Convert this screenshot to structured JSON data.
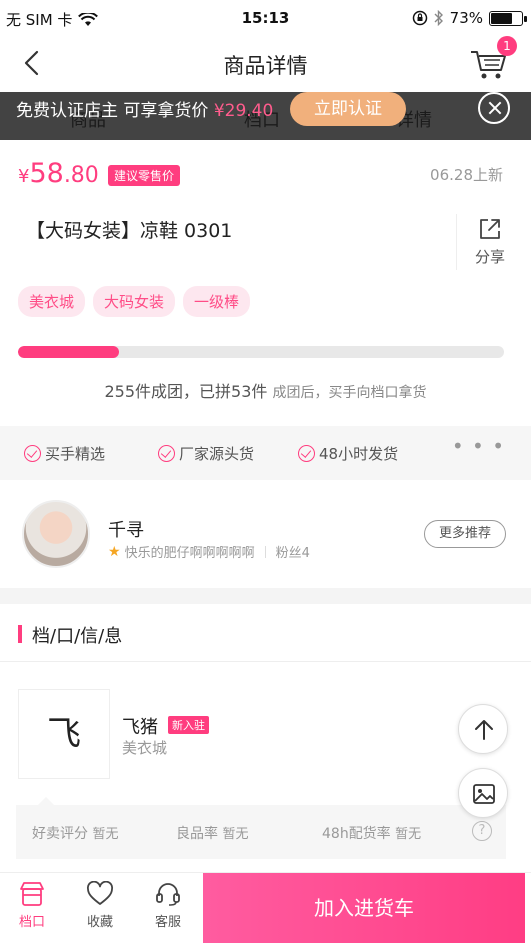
{
  "status_bar": {
    "carrier": "无 SIM 卡",
    "time": "15:13",
    "battery": "73%",
    "battery_level": 0.73
  },
  "nav": {
    "title": "商品详情",
    "cart_count": "1"
  },
  "ghost_tabs": [
    "商品",
    "档口",
    "详情"
  ],
  "promo": {
    "text": "免费认证店主 可享拿货价",
    "price": "¥29.40",
    "button": "立即认证"
  },
  "product": {
    "currency": "¥",
    "price_int": "58",
    "price_dec": ".80",
    "suggest_tag": "建议零售价",
    "date": "06.28上新",
    "title": "【大码女装】凉鞋 0301",
    "share_label": "分享",
    "tags": [
      "美衣城",
      "大码女装",
      "一级棒"
    ]
  },
  "group": {
    "progress": 0.208,
    "text_main": "255件成团，已拼53件",
    "text_sub": "成团后，买手向档口拿货"
  },
  "features": [
    "买手精选",
    "厂家源头货",
    "48小时发货"
  ],
  "more_dots": "• • •",
  "author": {
    "name": "千寻",
    "motto": "快乐的肥仔啊啊啊啊啊",
    "fans": "粉丝4",
    "more_button": "更多推荐"
  },
  "stall": {
    "section_title": "档/口/信/息",
    "logo_text": "飞",
    "name": "飞猪",
    "new_tag": "新入驻",
    "city": "美衣城",
    "ratings": [
      {
        "label": "好卖评分",
        "value": "暂无"
      },
      {
        "label": "良品率",
        "value": "暂无"
      },
      {
        "label": "48h配货率",
        "value": "暂无"
      }
    ],
    "help": "?"
  },
  "tabbar": {
    "items": [
      {
        "label": "档口",
        "icon": "shop-icon"
      },
      {
        "label": "收藏",
        "icon": "heart-icon"
      },
      {
        "label": "客服",
        "icon": "headset-icon"
      }
    ],
    "cta": "加入进货车"
  },
  "colors": {
    "accent": "#ff3d7f",
    "promo_button": "#f1b07c"
  }
}
